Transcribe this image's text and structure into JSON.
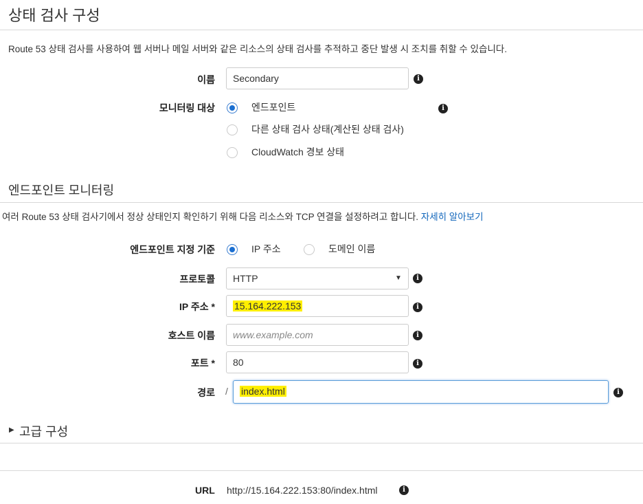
{
  "section1": {
    "title": "상태 검사 구성",
    "description": "Route 53 상태 검사를 사용하여 웹 서버나 메일 서버와 같은 리소스의 상태 검사를 추적하고 중단 발생 시 조치를 취할 수 있습니다."
  },
  "name_field": {
    "label": "이름",
    "value": "Secondary"
  },
  "monitor": {
    "label": "모니터링 대상",
    "options": [
      "엔드포인트",
      "다른 상태 검사 상태(계산된 상태 검사)",
      "CloudWatch 경보 상태"
    ],
    "selected": "엔드포인트"
  },
  "section2": {
    "title": "엔드포인트 모니터링",
    "description": "여러 Route 53 상태 검사기에서 정상 상태인지 확인하기 위해 다음 리소스와 TCP 연결을 설정하려고 합니다.",
    "learn_more": "자세히 알아보기"
  },
  "endpoint_spec": {
    "label": "엔드포인트 지정 기준",
    "options": [
      "IP 주소",
      "도메인 이름"
    ],
    "selected": "IP 주소"
  },
  "protocol": {
    "label": "프로토콜",
    "value": "HTTP"
  },
  "ip": {
    "label": "IP 주소 *",
    "value": "15.164.222.153"
  },
  "host": {
    "label": "호스트 이름",
    "placeholder": "www.example.com"
  },
  "port": {
    "label": "포트 *",
    "value": "80"
  },
  "path": {
    "label": "경로",
    "prefix": "/",
    "value": "index.html"
  },
  "advanced": {
    "label": "고급 구성"
  },
  "url": {
    "label": "URL",
    "value": "http://15.164.222.153:80/index.html"
  },
  "colors": {
    "link": "#1166bb",
    "highlight": "#ffef00",
    "radio_selected": "#1b6fd1"
  }
}
